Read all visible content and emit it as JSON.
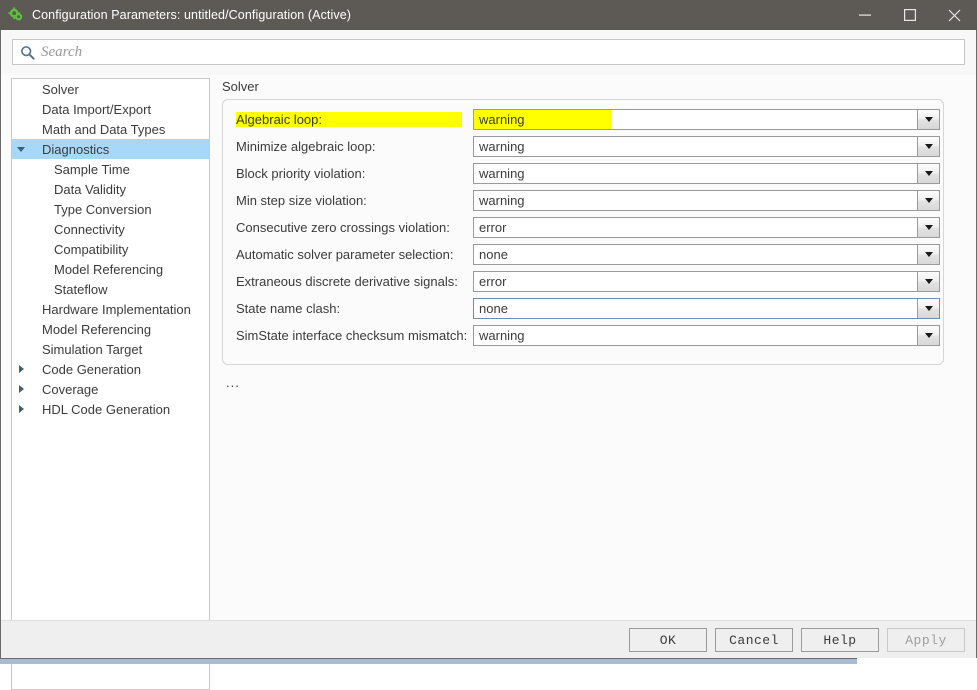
{
  "titlebar": {
    "icon": "simulink-gear-icon",
    "title": "Configuration Parameters: untitled/Configuration (Active)",
    "minimize_label": "minimize-icon",
    "maximize_label": "maximize-icon",
    "close_label": "close-icon"
  },
  "search": {
    "icon": "search-icon",
    "placeholder": "Search",
    "value": ""
  },
  "sidebar": {
    "items": [
      {
        "label": "Solver",
        "indent": 0,
        "arrow": "none",
        "selected": false
      },
      {
        "label": "Data Import/Export",
        "indent": 0,
        "arrow": "none",
        "selected": false
      },
      {
        "label": "Math and Data Types",
        "indent": 0,
        "arrow": "none",
        "selected": false
      },
      {
        "label": "Diagnostics",
        "indent": 0,
        "arrow": "down",
        "selected": true
      },
      {
        "label": "Sample Time",
        "indent": 1,
        "arrow": "none",
        "selected": false
      },
      {
        "label": "Data Validity",
        "indent": 1,
        "arrow": "none",
        "selected": false
      },
      {
        "label": "Type Conversion",
        "indent": 1,
        "arrow": "none",
        "selected": false
      },
      {
        "label": "Connectivity",
        "indent": 1,
        "arrow": "none",
        "selected": false
      },
      {
        "label": "Compatibility",
        "indent": 1,
        "arrow": "none",
        "selected": false
      },
      {
        "label": "Model Referencing",
        "indent": 1,
        "arrow": "none",
        "selected": false
      },
      {
        "label": "Stateflow",
        "indent": 1,
        "arrow": "none",
        "selected": false
      },
      {
        "label": "Hardware Implementation",
        "indent": 0,
        "arrow": "none",
        "selected": false
      },
      {
        "label": "Model Referencing",
        "indent": 0,
        "arrow": "none",
        "selected": false
      },
      {
        "label": "Simulation Target",
        "indent": 0,
        "arrow": "none",
        "selected": false
      },
      {
        "label": "Code Generation",
        "indent": 0,
        "arrow": "right",
        "selected": false
      },
      {
        "label": "Coverage",
        "indent": 0,
        "arrow": "right",
        "selected": false
      },
      {
        "label": "HDL Code Generation",
        "indent": 0,
        "arrow": "right",
        "selected": false
      }
    ]
  },
  "main": {
    "heading": "Solver",
    "ellipsis": "...",
    "rows": [
      {
        "label": "Algebraic loop:",
        "value": "warning",
        "highlighted": true,
        "focused": false
      },
      {
        "label": "Minimize algebraic loop:",
        "value": "warning",
        "highlighted": false,
        "focused": false
      },
      {
        "label": "Block priority violation:",
        "value": "warning",
        "highlighted": false,
        "focused": false
      },
      {
        "label": "Min step size violation:",
        "value": "warning",
        "highlighted": false,
        "focused": false
      },
      {
        "label": "Consecutive zero crossings violation:",
        "value": "error",
        "highlighted": false,
        "focused": false
      },
      {
        "label": "Automatic solver parameter selection:",
        "value": "none",
        "highlighted": false,
        "focused": false
      },
      {
        "label": "Extraneous discrete derivative signals:",
        "value": "error",
        "highlighted": false,
        "focused": false
      },
      {
        "label": "State name clash:",
        "value": "none",
        "highlighted": false,
        "focused": true
      },
      {
        "label": "SimState interface checksum mismatch:",
        "value": "warning",
        "highlighted": false,
        "focused": false
      }
    ]
  },
  "footer": {
    "buttons": [
      {
        "label": "OK",
        "disabled": false
      },
      {
        "label": "Cancel",
        "disabled": false
      },
      {
        "label": "Help",
        "disabled": false
      },
      {
        "label": "Apply",
        "disabled": true
      }
    ]
  },
  "colors": {
    "titlebar_bg": "#5d5a55",
    "selection_blue": "#a8d8f8",
    "highlight_yellow": "#ffff00",
    "accent_icon_green": "#5fbf3f"
  }
}
